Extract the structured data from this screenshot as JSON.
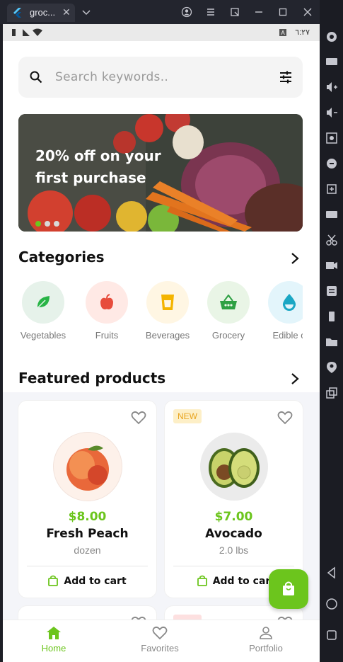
{
  "window": {
    "tab_title": "groc...",
    "tab_close": "✕"
  },
  "status": {
    "time": "٦:٢٧"
  },
  "search": {
    "placeholder": "Search keywords.."
  },
  "banner": {
    "text": "20% off on your first purchase",
    "slides": 3,
    "active_slide": 1
  },
  "categories": {
    "title": "Categories",
    "items": [
      {
        "label": "Vegetables",
        "icon": "leaf-icon",
        "bg": "#e6f2ea",
        "color": "#28b446"
      },
      {
        "label": "Fruits",
        "icon": "apple-icon",
        "bg": "#ffe9e5",
        "color": "#e74c3c"
      },
      {
        "label": "Beverages",
        "icon": "cup-icon",
        "bg": "#fff6e3",
        "color": "#f4b400"
      },
      {
        "label": "Grocery",
        "icon": "basket-icon",
        "bg": "#e9f5e6",
        "color": "#2ea043"
      },
      {
        "label": "Edible o",
        "icon": "drop-icon",
        "bg": "#e3f5fb",
        "color": "#1ba7c4"
      }
    ]
  },
  "featured": {
    "title": "Featured products",
    "products": [
      {
        "badge": "",
        "price": "$8.00",
        "name": "Fresh Peach",
        "unit": "dozen",
        "cart": "Add to cart"
      },
      {
        "badge": "NEW",
        "price": "$7.00",
        "name": "Avocado",
        "unit": "2.0 lbs",
        "cart": "Add to car"
      }
    ]
  },
  "nav": {
    "items": [
      {
        "label": "Home",
        "icon": "home-icon",
        "active": true
      },
      {
        "label": "Favorites",
        "icon": "heart-icon",
        "active": false
      },
      {
        "label": "Portfolio",
        "icon": "person-icon",
        "active": false
      }
    ]
  },
  "colors": {
    "accent": "#6cc51d",
    "badge_bg": "#fdefc7",
    "badge_text": "#e8a31d"
  }
}
